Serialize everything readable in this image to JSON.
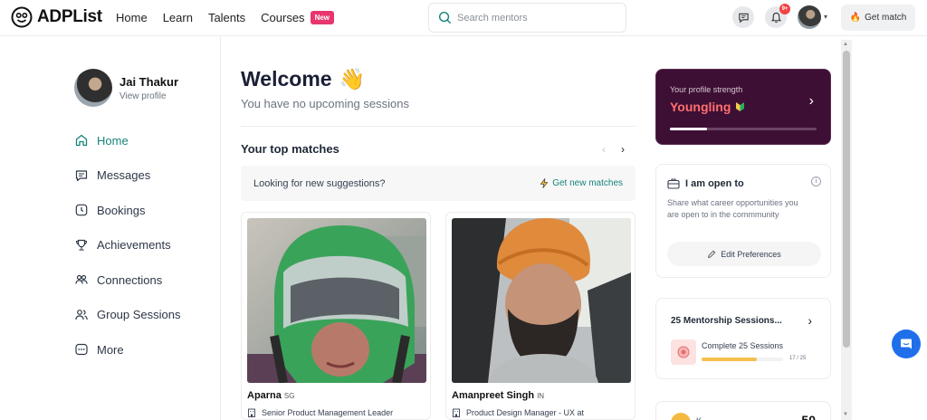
{
  "header": {
    "logo_text": "ADPList",
    "nav": [
      {
        "label": "Home"
      },
      {
        "label": "Learn"
      },
      {
        "label": "Talents"
      },
      {
        "label": "Courses",
        "badge": "New"
      }
    ],
    "search_placeholder": "Search mentors",
    "notification_count": "9+",
    "get_match_label": "Get match"
  },
  "sidebar": {
    "user_name": "Jai Thakur",
    "view_profile": "View profile",
    "items": [
      {
        "label": "Home",
        "icon": "home-icon",
        "active": true
      },
      {
        "label": "Messages",
        "icon": "message-icon"
      },
      {
        "label": "Bookings",
        "icon": "clock-icon"
      },
      {
        "label": "Achievements",
        "icon": "trophy-icon"
      },
      {
        "label": "Connections",
        "icon": "connections-icon"
      },
      {
        "label": "Group Sessions",
        "icon": "group-icon"
      },
      {
        "label": "More",
        "icon": "more-icon"
      }
    ]
  },
  "main": {
    "welcome": "Welcome",
    "welcome_emoji": "👋",
    "sessions_status": "You have no upcoming sessions",
    "top_matches_title": "Your top matches",
    "suggestion_text": "Looking for new suggestions?",
    "get_new_matches": "Get new matches",
    "mentors": [
      {
        "name": "Aparna",
        "country": "SG",
        "role": "Senior Product Management Leader"
      },
      {
        "name": "Amanpreet Singh",
        "country": "IN",
        "role": "Product Design Manager - UX at"
      }
    ]
  },
  "right": {
    "profile_strength_label": "Your profile strength",
    "profile_level": "Youngling",
    "profile_progress": 0.25,
    "open_to_title": "I am open to",
    "open_to_desc": "Share what career opportunities you are open to in the commmunity",
    "edit_preferences": "Edit Preferences",
    "mentorship_title": "25 Mentorship Sessions...",
    "mentorship_task": "Complete 25 Sessions",
    "mentorship_count": "17 / 25",
    "mentorship_progress": 0.68,
    "peek_text": "K",
    "peek_number": "50"
  },
  "colors": {
    "brand_teal": "#16847a",
    "strength_bg": "#3d0f34",
    "level_red": "#ff6f6f",
    "new_badge": "#e8356d",
    "progress_yellow": "#f5c04c",
    "chat_blue": "#1f6feb"
  }
}
